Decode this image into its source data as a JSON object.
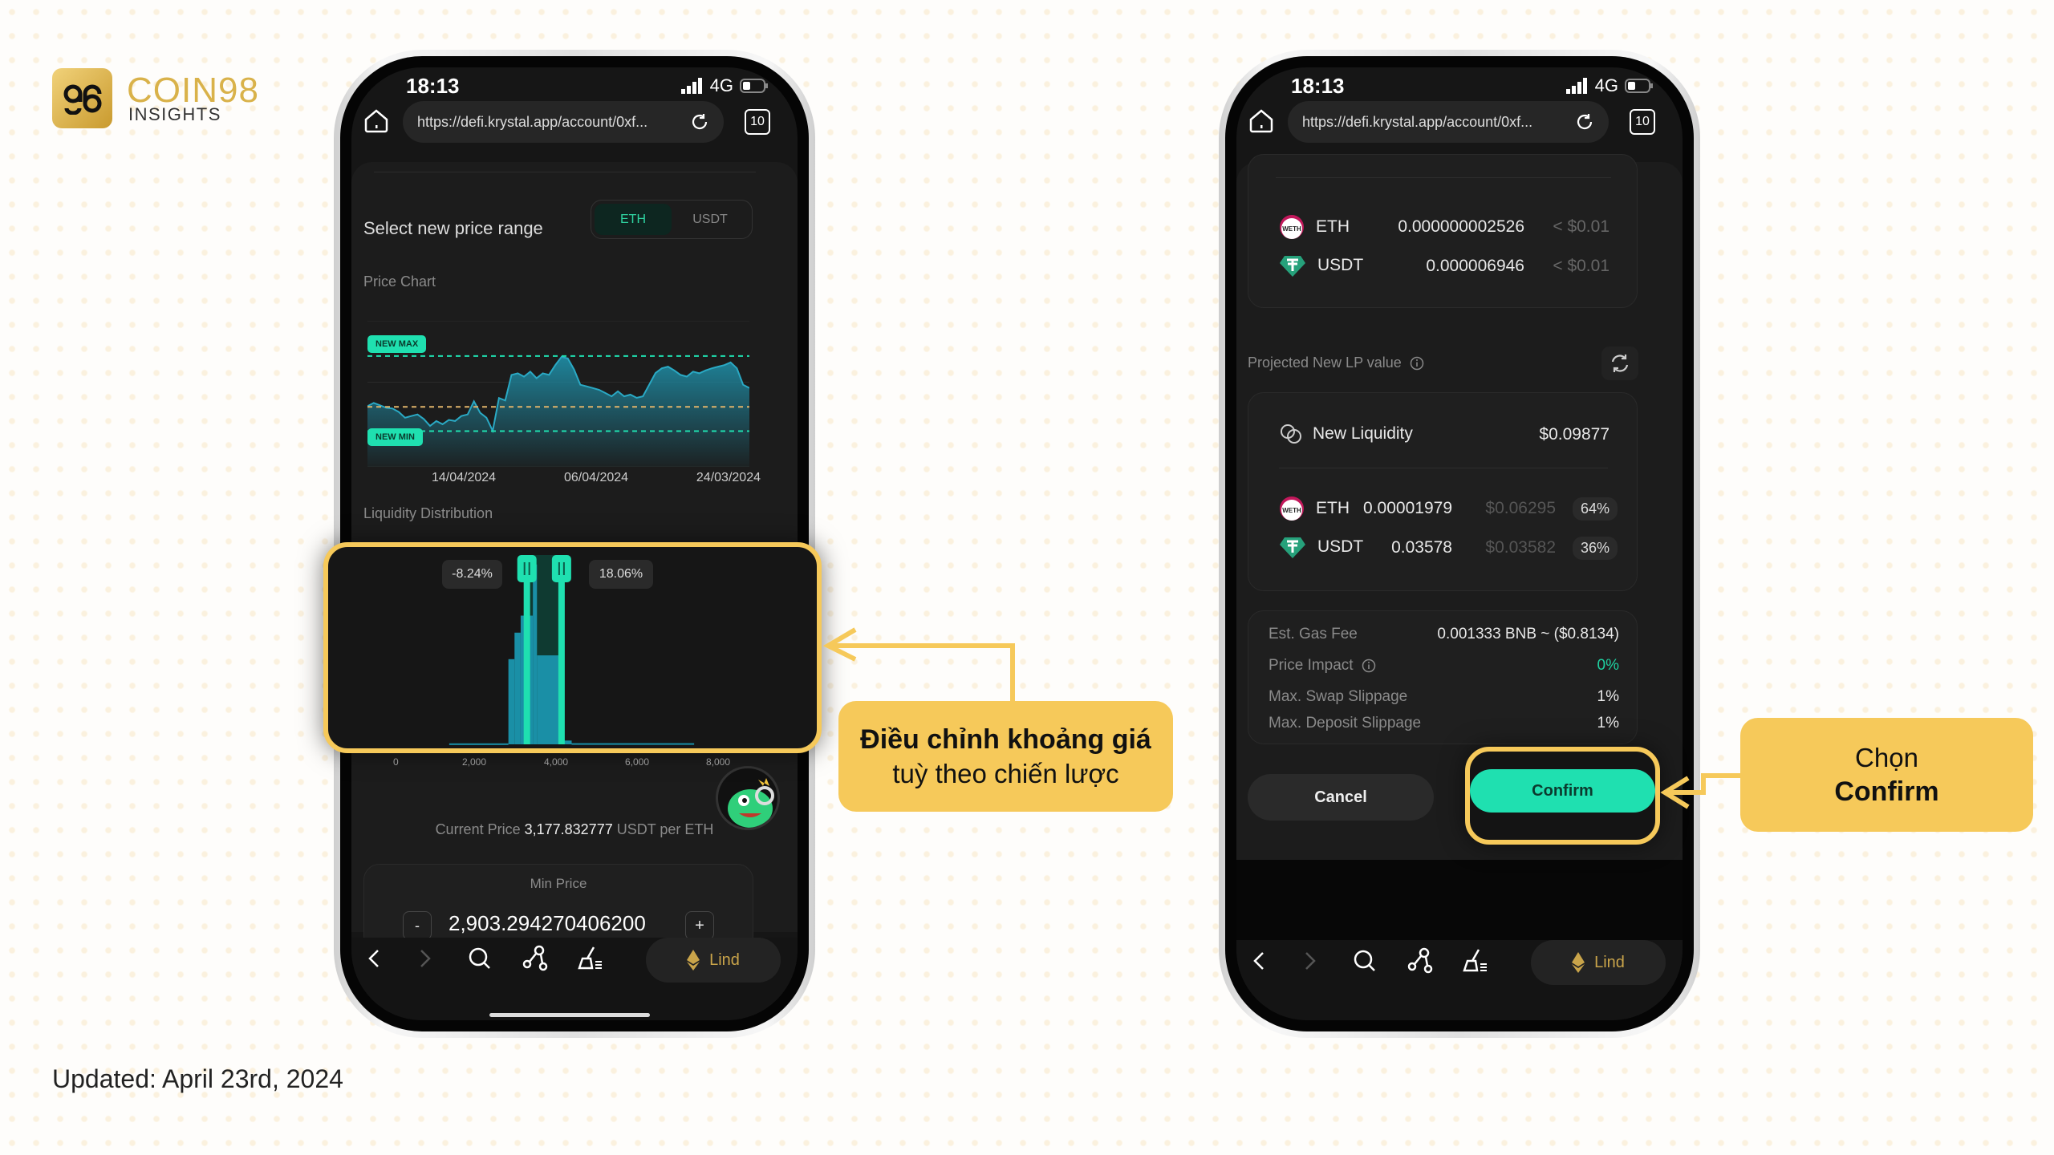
{
  "brand": {
    "logo_glyph": "98",
    "name": "COIN98",
    "sub": "INSIGHTS"
  },
  "updated": "Updated: April 23rd, 2024",
  "colors": {
    "accent": "#1fe0b0",
    "callout": "#f6c95a",
    "gold": "#c9a44a",
    "chart_line": "#2aa9c4"
  },
  "status": {
    "time": "18:13",
    "network": "4G"
  },
  "browser": {
    "url": "https://defi.krystal.app/account/0xf...",
    "tabs_count": "10",
    "wallet_label": "Lind"
  },
  "left": {
    "title": "Select new price range",
    "toggle": [
      {
        "label": "ETH",
        "active": true
      },
      {
        "label": "USDT",
        "active": false
      }
    ],
    "price_chart_label": "Price Chart",
    "new_max": "NEW MAX",
    "new_min": "NEW MIN",
    "dates": [
      "14/04/2024",
      "06/04/2024",
      "24/03/2024"
    ],
    "liquidity_label": "Liquidity Distribution",
    "range_low_pct": "-8.24%",
    "range_high_pct": "18.06%",
    "axis_ticks": [
      "0",
      "2,000",
      "4,000",
      "6,000",
      "8,000"
    ],
    "current_price_label": "Current Price",
    "current_price": "3,177.832777",
    "current_price_unit": "USDT per ETH",
    "min_price_label": "Min Price",
    "min_price_value": "2,903.294270406200",
    "minus": "-",
    "plus": "+"
  },
  "chart_data": [
    {
      "type": "area",
      "title": "Price Chart",
      "x_ticks": [
        "14/04/2024",
        "06/04/2024",
        "24/03/2024"
      ],
      "ylim": [
        2500,
        4150
      ],
      "new_max": 3752,
      "new_min": 2903,
      "current": 3178,
      "values": [
        3185,
        3223,
        3195,
        3167,
        3159,
        3120,
        3055,
        3074,
        3092,
        3040,
        2962,
        3018,
        2981,
        3030,
        3018,
        3074,
        3092,
        3241,
        3110,
        3055,
        2906,
        3278,
        3250,
        3539,
        3557,
        3520,
        3576,
        3502,
        3557,
        3540,
        3650,
        3743,
        3725,
        3600,
        3427,
        3409,
        3390,
        3370,
        3334,
        3297,
        3353,
        3297,
        3316,
        3280,
        3297,
        3427,
        3560,
        3613,
        3632,
        3590,
        3539,
        3520,
        3576,
        3557,
        3590,
        3613,
        3632,
        3650,
        3680,
        3613,
        3427,
        3390
      ]
    },
    {
      "type": "bar",
      "title": "Liquidity Distribution",
      "xlim": [
        0,
        8000
      ],
      "x_ticks": [
        "0",
        "2,000",
        "4,000",
        "6,000",
        "8,000"
      ],
      "range": [
        2903,
        3752
      ],
      "bars": [
        {
          "from": 1000,
          "to": 2450,
          "value": 0.005
        },
        {
          "from": 2450,
          "to": 2600,
          "value": 0.45
        },
        {
          "from": 2600,
          "to": 2750,
          "value": 0.59
        },
        {
          "from": 2750,
          "to": 2900,
          "value": 0.68
        },
        {
          "from": 2900,
          "to": 3050,
          "value": 0.68
        },
        {
          "from": 3050,
          "to": 3150,
          "value": 0.95
        },
        {
          "from": 3150,
          "to": 3800,
          "value": 0.47
        },
        {
          "from": 3800,
          "to": 4000,
          "value": 0.02
        },
        {
          "from": 4000,
          "to": 7000,
          "value": 0.006
        }
      ]
    }
  ],
  "right": {
    "current_tokens": [
      {
        "icon": "weth-icon",
        "symbol": "ETH",
        "amount": "0.000000002526",
        "usd": "< $0.01"
      },
      {
        "icon": "usdt-icon",
        "symbol": "USDT",
        "amount": "0.000006946",
        "usd": "< $0.01"
      }
    ],
    "projected_label": "Projected New LP value",
    "new_liquidity_label": "New Liquidity",
    "new_liquidity_value": "$0.09877",
    "new_tokens": [
      {
        "symbol": "ETH",
        "amount": "0.00001979",
        "usd": "$0.06295",
        "pct": "64%"
      },
      {
        "symbol": "USDT",
        "amount": "0.03578",
        "usd": "$0.03582",
        "pct": "36%"
      }
    ],
    "fees": [
      {
        "label": "Est. Gas Fee",
        "value": "0.001333 BNB ~ ($0.8134)"
      },
      {
        "label": "Price Impact",
        "value": "0%",
        "info": true
      },
      {
        "label": "Max. Swap Slippage",
        "value": "1%"
      },
      {
        "label": "Max. Deposit Slippage",
        "value": "1%"
      }
    ],
    "cancel": "Cancel",
    "confirm": "Confirm"
  },
  "callouts": {
    "left_bold": "Điều chỉnh khoảng giá",
    "left_normal": "tuỳ theo chiến lược",
    "right_normal": "Chọn",
    "right_bold": "Confirm"
  }
}
